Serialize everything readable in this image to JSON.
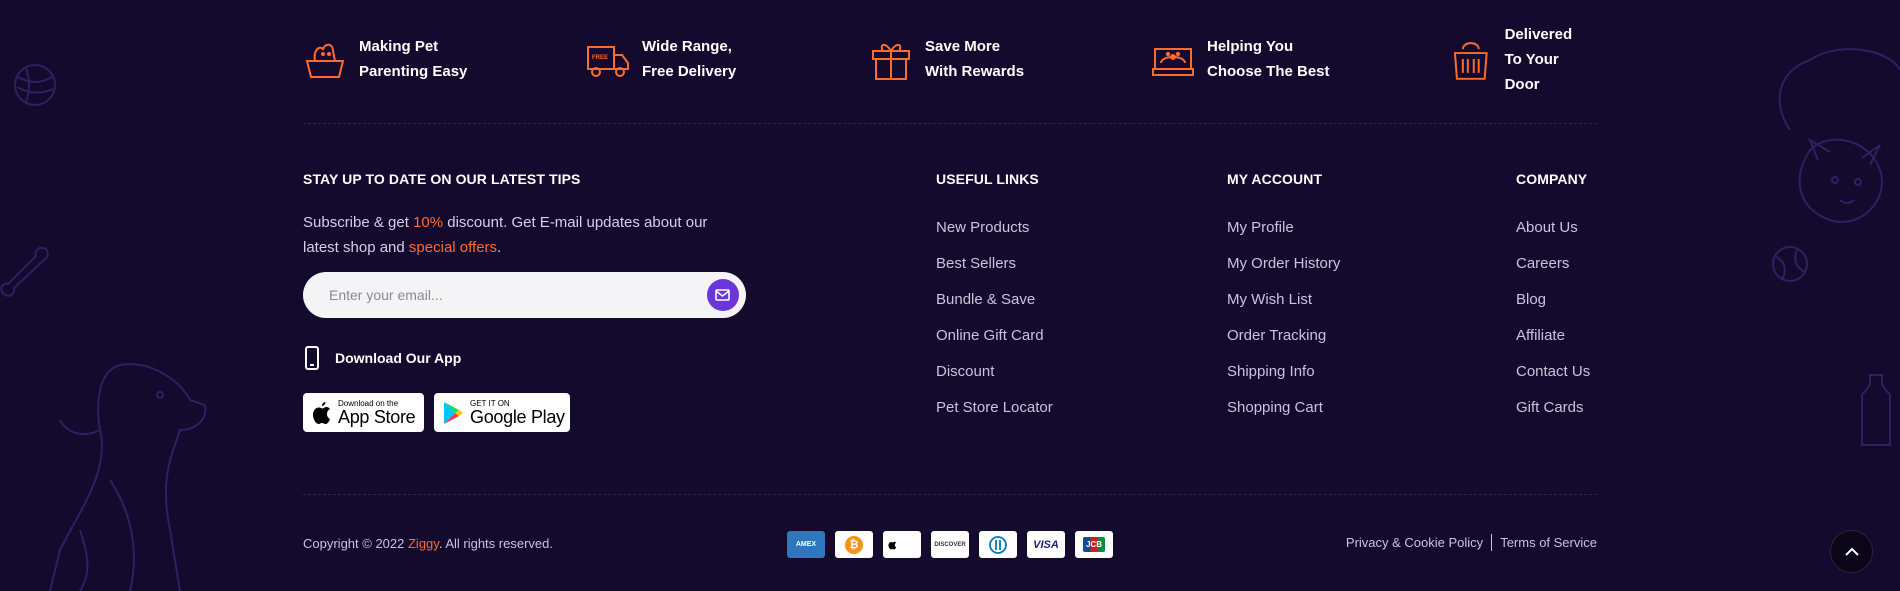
{
  "features": [
    {
      "icon": "pet-basket-icon",
      "line1": "Making Pet",
      "line2": "Parenting Easy"
    },
    {
      "icon": "delivery-truck-icon",
      "line1": "Wide Range,",
      "line2": "Free Delivery",
      "truck_badge": "FREE"
    },
    {
      "icon": "gift-icon",
      "line1": "Save More",
      "line2": "With Rewards"
    },
    {
      "icon": "pet-bed-icon",
      "line1": "Helping You",
      "line2": "Choose The Best"
    },
    {
      "icon": "pet-carrier-icon",
      "line1": "Delivered",
      "line2": "To Your Door"
    }
  ],
  "newsletter": {
    "title": "STAY UP TO DATE ON OUR LATEST TIPS",
    "text_1": "Subscribe & get ",
    "highlight_1": "10%",
    "text_2": " discount. Get E-mail updates about our latest shop and ",
    "highlight_2": "special offers",
    "text_3": ".",
    "email_placeholder": "Enter your email...",
    "send_icon": "mail-send-icon"
  },
  "app": {
    "label": "Download Our App",
    "icon": "phone-icon",
    "app_store": {
      "small": "Download on the",
      "big": "App Store"
    },
    "google_play": {
      "small": "GET IT ON",
      "big": "Google Play"
    }
  },
  "columns": [
    {
      "title": "USEFUL LINKS",
      "items": [
        "New Products",
        "Best Sellers",
        "Bundle & Save",
        "Online Gift Card",
        "Discount",
        "Pet Store Locator"
      ]
    },
    {
      "title": "MY ACCOUNT",
      "items": [
        "My Profile",
        "My Order History",
        "My Wish List",
        "Order Tracking",
        "Shipping Info",
        "Shopping Cart"
      ]
    },
    {
      "title": "COMPANY",
      "items": [
        "About Us",
        "Careers",
        "Blog",
        "Affiliate",
        "Contact Us",
        "Gift Cards"
      ]
    }
  ],
  "footer": {
    "copyright_prefix": "Copyright © 2022 ",
    "brand": "Ziggy",
    "copyright_suffix": ". All rights reserved.",
    "payments": [
      {
        "name": "amex-icon",
        "label": "AMEX"
      },
      {
        "name": "bitcoin-icon",
        "label": "₿"
      },
      {
        "name": "apple-pay-icon",
        "label": "Pay"
      },
      {
        "name": "discover-icon",
        "label": "DISCOVER"
      },
      {
        "name": "diners-club-icon",
        "label": ""
      },
      {
        "name": "visa-icon",
        "label": "VISA"
      },
      {
        "name": "jcb-icon",
        "label": "JCB"
      }
    ],
    "privacy": "Privacy & Cookie Policy",
    "terms": "Terms of Service"
  },
  "colors": {
    "background": "#130a2e",
    "accent": "#ff6a2f",
    "button": "#6a35d9"
  }
}
